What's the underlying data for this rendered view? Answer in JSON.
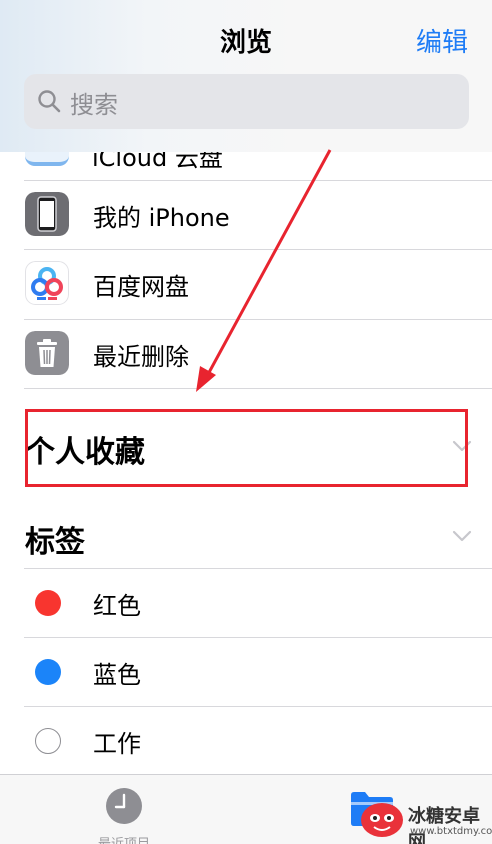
{
  "nav": {
    "title": "浏览",
    "edit_label": "编辑"
  },
  "search": {
    "placeholder": "搜索"
  },
  "locations": [
    {
      "label": "iCloud 云盘",
      "icon": "icloud-icon"
    },
    {
      "label": "我的 iPhone",
      "icon": "iphone-icon"
    },
    {
      "label": "百度网盘",
      "icon": "baidu-netdisk-icon"
    },
    {
      "label": "最近删除",
      "icon": "trash-icon"
    }
  ],
  "favorites": {
    "title": "个人收藏"
  },
  "tags": {
    "title": "标签",
    "items": [
      {
        "label": "红色",
        "color": "#f8352f"
      },
      {
        "label": "蓝色",
        "color": "#1b84f9"
      },
      {
        "label": "工作",
        "color": ""
      }
    ]
  },
  "tabbar": {
    "recent_label": "最近项目"
  },
  "watermark": {
    "name": "冰糖安卓网",
    "url": "www.btxtdmy.com"
  },
  "colors": {
    "accent": "#1e7cf6",
    "highlight_box": "#e8242f"
  }
}
